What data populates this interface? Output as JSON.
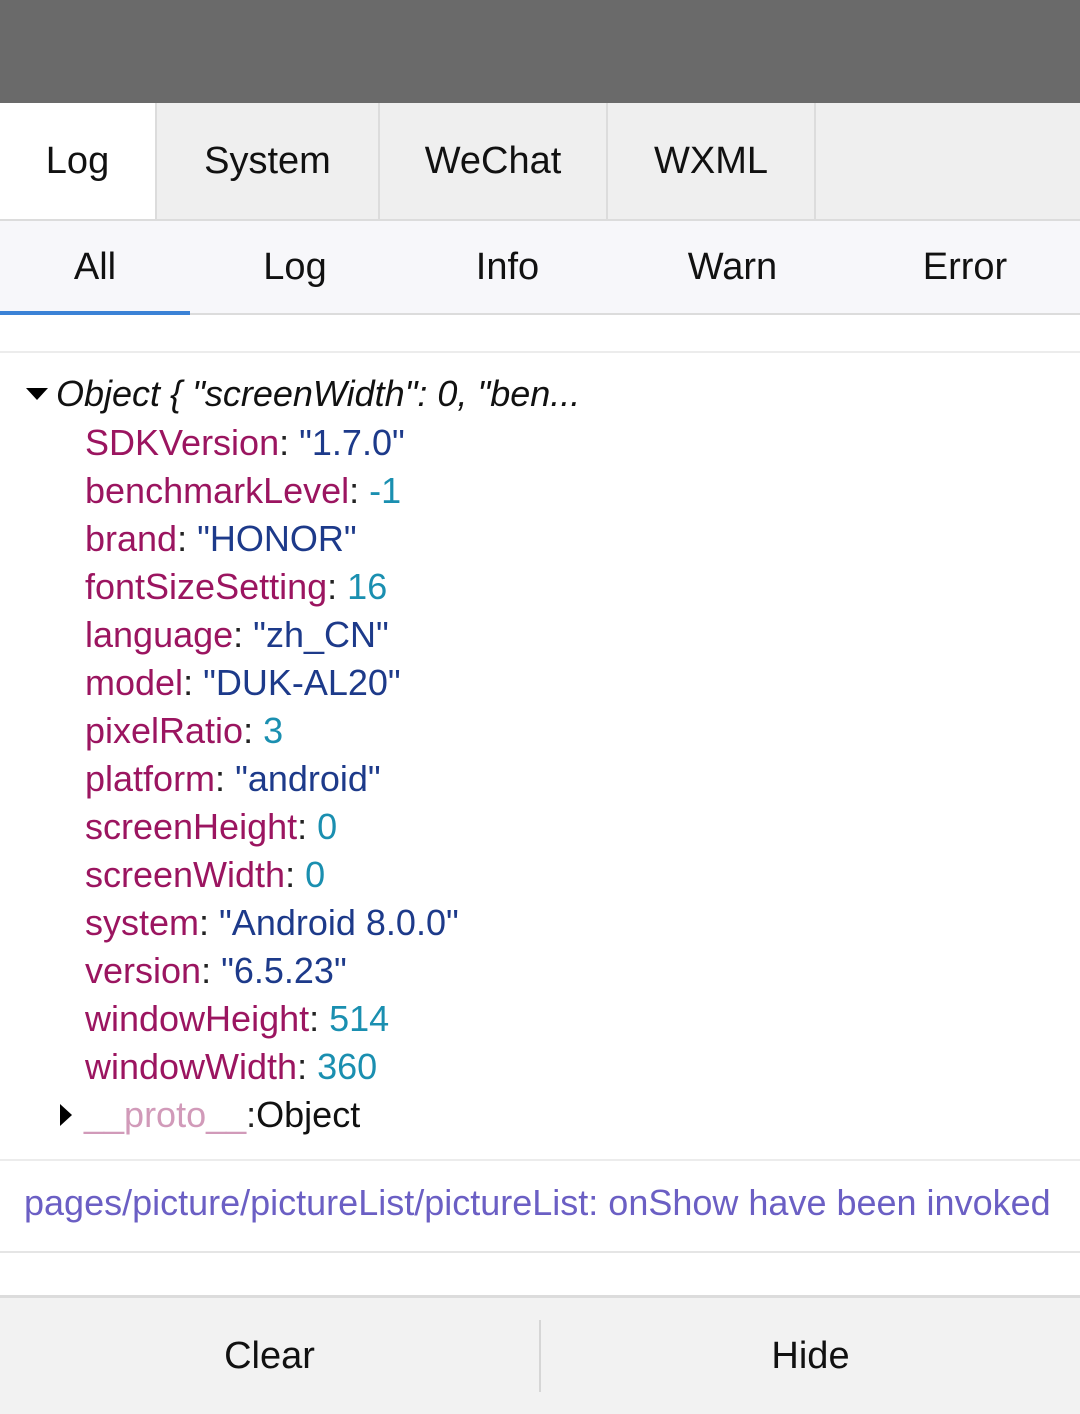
{
  "main_tabs": [
    {
      "label": "Log",
      "active": true
    },
    {
      "label": "System",
      "active": false
    },
    {
      "label": "WeChat",
      "active": false
    },
    {
      "label": "WXML",
      "active": false
    }
  ],
  "sub_tabs": [
    {
      "label": "All",
      "active": true
    },
    {
      "label": "Log",
      "active": false
    },
    {
      "label": "Info",
      "active": false
    },
    {
      "label": "Warn",
      "active": false
    },
    {
      "label": "Error",
      "active": false
    }
  ],
  "log_object": {
    "summary": "Object { \"screenWidth\": 0, \"ben...",
    "properties": [
      {
        "key": "SDKVersion",
        "value": "\"1.7.0\"",
        "type": "string"
      },
      {
        "key": "benchmarkLevel",
        "value": "-1",
        "type": "number"
      },
      {
        "key": "brand",
        "value": "\"HONOR\"",
        "type": "string"
      },
      {
        "key": "fontSizeSetting",
        "value": "16",
        "type": "number"
      },
      {
        "key": "language",
        "value": "\"zh_CN\"",
        "type": "string"
      },
      {
        "key": "model",
        "value": "\"DUK-AL20\"",
        "type": "string"
      },
      {
        "key": "pixelRatio",
        "value": "3",
        "type": "number"
      },
      {
        "key": "platform",
        "value": "\"android\"",
        "type": "string"
      },
      {
        "key": "screenHeight",
        "value": "0",
        "type": "number"
      },
      {
        "key": "screenWidth",
        "value": "0",
        "type": "number"
      },
      {
        "key": "system",
        "value": "\"Android 8.0.0\"",
        "type": "string"
      },
      {
        "key": "version",
        "value": "\"6.5.23\"",
        "type": "string"
      },
      {
        "key": "windowHeight",
        "value": "514",
        "type": "number"
      },
      {
        "key": "windowWidth",
        "value": "360",
        "type": "number"
      }
    ],
    "proto_key": "__proto__",
    "proto_value": "Object"
  },
  "log_message": "pages/picture/pictureList/pictureList: onShow have been invoked",
  "bottom_bar": {
    "clear_label": "Clear",
    "hide_label": "Hide"
  },
  "colors": {
    "key": "#9b1560",
    "string": "#1d3a8a",
    "number": "#1a8fb0",
    "log_message": "#6b5fc4",
    "tab_underline": "#3b82d6"
  }
}
